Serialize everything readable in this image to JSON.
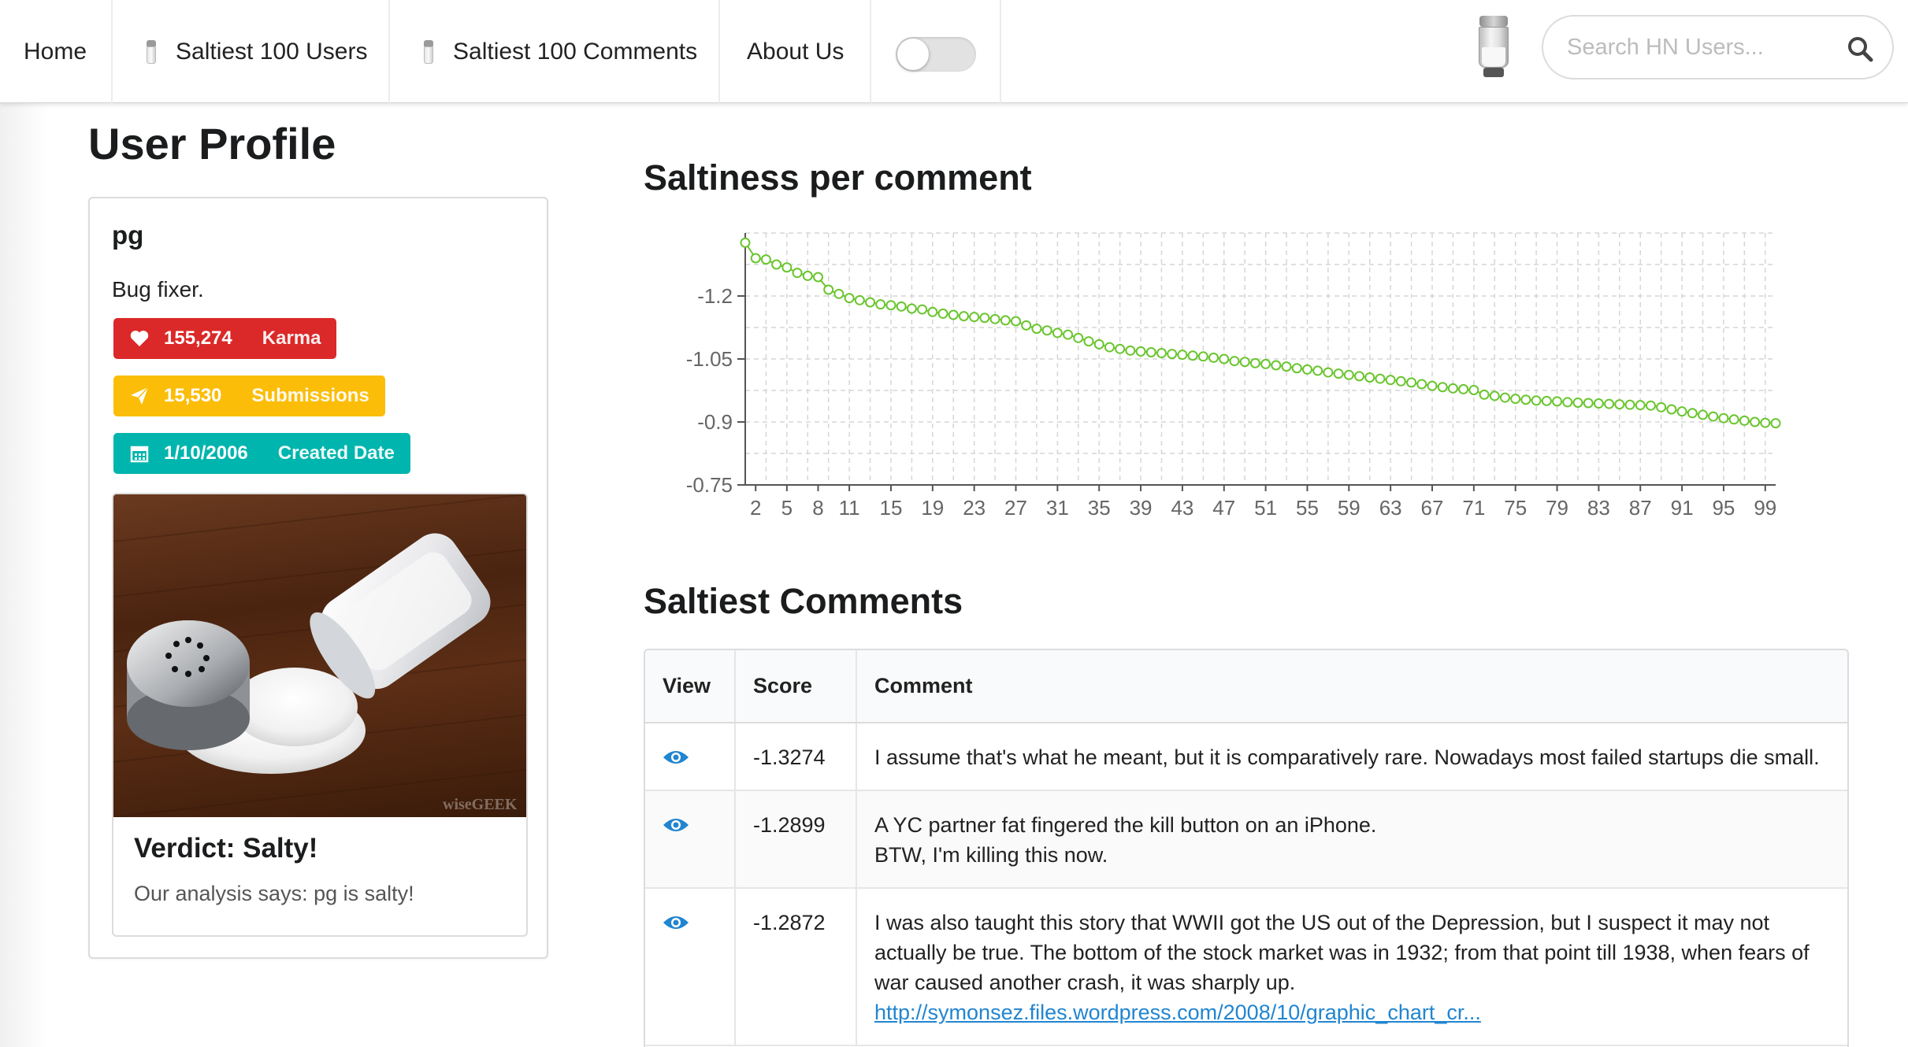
{
  "nav": {
    "home": "Home",
    "users": "Saltiest 100 Users",
    "comments": "Saltiest 100 Comments",
    "about": "About Us",
    "search_placeholder": "Search HN Users..."
  },
  "profile": {
    "heading": "User Profile",
    "username": "pg",
    "about": "Bug fixer.",
    "karma": {
      "value": "155,274",
      "label": "Karma"
    },
    "submissions": {
      "value": "15,530",
      "label": "Submissions"
    },
    "created": {
      "value": "1/10/2006",
      "label": "Created Date"
    },
    "image_watermark": "wiseGEEK",
    "verdict_title": "Verdict: Salty!",
    "verdict_desc": "Our analysis says: pg is salty!"
  },
  "chart_section": {
    "title": "Saltiness per comment"
  },
  "chart_data": {
    "type": "line",
    "title": "Saltiness per comment",
    "color": "#6ac52e",
    "x_ticks": [
      2,
      5,
      8,
      11,
      15,
      19,
      23,
      27,
      31,
      35,
      39,
      43,
      47,
      51,
      55,
      59,
      63,
      67,
      71,
      75,
      79,
      83,
      87,
      91,
      95,
      99
    ],
    "y_ticks": [
      -1.2,
      -1.05,
      -0.9,
      -0.75
    ],
    "y_range_top": -1.35,
    "y_range_bottom": -0.75,
    "y_axis_inverted": true,
    "grid": true,
    "x": [
      1,
      2,
      3,
      4,
      5,
      6,
      7,
      8,
      9,
      10,
      11,
      12,
      13,
      14,
      15,
      16,
      17,
      18,
      19,
      20,
      21,
      22,
      23,
      24,
      25,
      26,
      27,
      28,
      29,
      30,
      31,
      32,
      33,
      34,
      35,
      36,
      37,
      38,
      39,
      40,
      41,
      42,
      43,
      44,
      45,
      46,
      47,
      48,
      49,
      50,
      51,
      52,
      53,
      54,
      55,
      56,
      57,
      58,
      59,
      60,
      61,
      62,
      63,
      64,
      65,
      66,
      67,
      68,
      69,
      70,
      71,
      72,
      73,
      74,
      75,
      76,
      77,
      78,
      79,
      80,
      81,
      82,
      83,
      84,
      85,
      86,
      87,
      88,
      89,
      90,
      91,
      92,
      93,
      94,
      95,
      96,
      97,
      98,
      99,
      100
    ],
    "values": [
      -1.327,
      -1.29,
      -1.287,
      -1.275,
      -1.268,
      -1.255,
      -1.248,
      -1.245,
      -1.215,
      -1.205,
      -1.195,
      -1.19,
      -1.185,
      -1.18,
      -1.178,
      -1.175,
      -1.17,
      -1.168,
      -1.162,
      -1.158,
      -1.155,
      -1.152,
      -1.15,
      -1.148,
      -1.145,
      -1.142,
      -1.14,
      -1.13,
      -1.122,
      -1.118,
      -1.112,
      -1.108,
      -1.1,
      -1.092,
      -1.085,
      -1.078,
      -1.074,
      -1.07,
      -1.068,
      -1.066,
      -1.064,
      -1.062,
      -1.06,
      -1.058,
      -1.056,
      -1.053,
      -1.05,
      -1.045,
      -1.043,
      -1.04,
      -1.038,
      -1.035,
      -1.032,
      -1.028,
      -1.025,
      -1.022,
      -1.018,
      -1.015,
      -1.012,
      -1.009,
      -1.006,
      -1.003,
      -1.0,
      -0.997,
      -0.994,
      -0.99,
      -0.986,
      -0.983,
      -0.98,
      -0.978,
      -0.976,
      -0.965,
      -0.962,
      -0.958,
      -0.955,
      -0.953,
      -0.951,
      -0.95,
      -0.949,
      -0.947,
      -0.946,
      -0.945,
      -0.944,
      -0.943,
      -0.942,
      -0.941,
      -0.94,
      -0.939,
      -0.935,
      -0.93,
      -0.925,
      -0.921,
      -0.917,
      -0.913,
      -0.909,
      -0.906,
      -0.903,
      -0.9,
      -0.898,
      -0.897
    ]
  },
  "comments_section": {
    "title": "Saltiest Comments",
    "headers": {
      "view": "View",
      "score": "Score",
      "comment": "Comment"
    },
    "rows": [
      {
        "score": "-1.3274",
        "line1": "I assume that's what he meant, but it is comparatively rare. Nowadays most failed startups die small.",
        "line2": "",
        "link": ""
      },
      {
        "score": "-1.2899",
        "line1": "A YC partner fat fingered the kill button on an iPhone.",
        "line2": "BTW, I'm killing this now.",
        "link": ""
      },
      {
        "score": "-1.2872",
        "line1": "I was also taught this story that WWII got the US out of the Depression, but I suspect it may not actually be true. The bottom of the stock market was in 1932; from that point till 1938, when fears of war caused another crash, it was sharply up.",
        "line2": "",
        "link": "http://symonsez.files.wordpress.com/2008/10/graphic_chart_cr..."
      }
    ]
  }
}
